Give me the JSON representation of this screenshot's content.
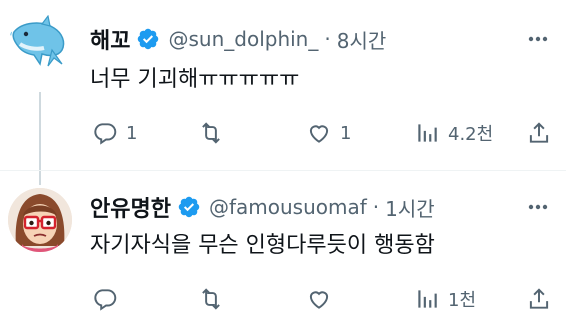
{
  "tweets": [
    {
      "display_name": "해꼬",
      "handle": "@sun_dolphin_",
      "time": "8시간",
      "text": "너무 기괴해ㅠㅠㅠㅠㅠ",
      "reply_count": "1",
      "like_count": "1",
      "view_count": "4.2천",
      "avatar": "dolphin-icon"
    },
    {
      "display_name": "안유명한",
      "handle": "@famousuomaf",
      "time": "1시간",
      "text": "자기자식을 무슨 인형다루듯이 행동함",
      "reply_count": "",
      "like_count": "",
      "view_count": "1천",
      "avatar": "glasses-girl-icon"
    }
  ],
  "separator": "·",
  "colors": {
    "text": "#0f1419",
    "secondary": "#536471",
    "verified": "#1d9bf0",
    "line": "#cfd9de"
  }
}
